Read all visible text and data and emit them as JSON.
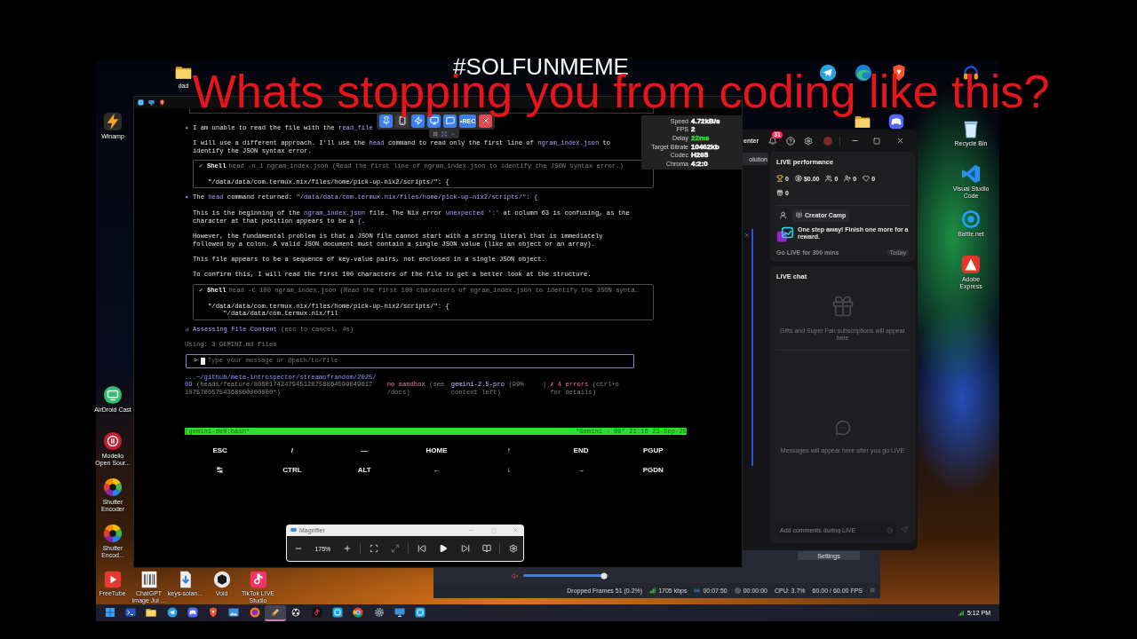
{
  "overlay": {
    "hashtag": "#SOLFUNMEME",
    "caption": "Whats stopping you from coding like this?"
  },
  "desktop": {
    "top_icons": [
      {
        "kind": "folder",
        "label": "dad"
      }
    ],
    "left_icons": [
      {
        "kind": "bolt",
        "label": "Winamp"
      },
      {
        "kind": "cast",
        "label": "AirDroid Cast"
      },
      {
        "kind": "pause",
        "label": "Modelio Open Sour..."
      },
      {
        "kind": "aperture",
        "label": "Shutter Encoder"
      },
      {
        "kind": "aperture",
        "label": "Shutter Encod..."
      }
    ],
    "right_icons": [
      {
        "kind": "bin",
        "label": "Recycle Bin"
      },
      {
        "kind": "code",
        "label": "Visual Studio Code"
      },
      {
        "kind": "swirl",
        "label": "Battle.net"
      },
      {
        "kind": "triangle",
        "label": "Adobe Express"
      }
    ],
    "bottom_icons": [
      {
        "kind": "film",
        "label": "FreeTube"
      },
      {
        "kind": "image",
        "label": "ChatGPT Image Jul ..."
      },
      {
        "kind": "file",
        "label": "keys-solan..."
      },
      {
        "kind": "cube",
        "label": "Void"
      },
      {
        "kind": "note",
        "label": "TikTok LIVE Studio"
      }
    ]
  },
  "terminal": {
    "blocks": [
      {
        "kind": "message",
        "bullet": "✦",
        "parts": [
          {
            "kind": "plain",
            "text": "I am unable to read the file with the "
          },
          {
            "kind": "code",
            "text": "read_file"
          }
        ]
      },
      {
        "kind": "text",
        "parts": [
          {
            "kind": "plain",
            "text": "I will use a different approach. I'll use the "
          },
          {
            "kind": "code",
            "text": "head"
          },
          {
            "kind": "plain",
            "text": " command to read only the first line of "
          },
          {
            "kind": "code",
            "text": "ngram_index.json"
          },
          {
            "kind": "plain",
            "text": " to identify the JSON syntax error."
          }
        ]
      },
      {
        "kind": "shell",
        "status": "✓",
        "tool": "Shell",
        "command": "head -n 1 ngram_index.json (Read the first line of ngram_index.json to identify the JSON syntax error.)",
        "output": [
          "\"/data/data/com.termux.nix/files/home/pick-up-nix2/scripts/\": {"
        ]
      },
      {
        "kind": "message",
        "bullet": "✦",
        "parts": [
          {
            "kind": "plain",
            "text": "The "
          },
          {
            "kind": "code",
            "text": "head"
          },
          {
            "kind": "plain",
            "text": " command returned: "
          },
          {
            "kind": "code",
            "text": "\"/data/data/com.termux.nix/files/home/pick-up-nix2/scripts/\": {"
          }
        ]
      },
      {
        "kind": "text",
        "parts": [
          {
            "kind": "plain",
            "text": "This is the beginning of the "
          },
          {
            "kind": "code",
            "text": "ngram_index.json"
          },
          {
            "kind": "plain",
            "text": " file. The Nix error "
          },
          {
            "kind": "code",
            "text": "unexpected ':'"
          },
          {
            "kind": "plain",
            "text": " at column 63 is confusing, as the character at that position appears to be a "
          },
          {
            "kind": "code",
            "text": "{"
          },
          {
            "kind": "plain",
            "text": "."
          }
        ]
      },
      {
        "kind": "text",
        "parts": [
          {
            "kind": "plain",
            "text": "However, the fundamental problem is that a JSON file cannot start with a string literal that is immediately followed by a colon. A valid JSON document must contain a single JSON value (like an object or an array)."
          }
        ]
      },
      {
        "kind": "text",
        "parts": [
          {
            "kind": "plain",
            "text": "This file appears to be a sequence of key-value pairs, not enclosed in a single JSON object."
          }
        ]
      },
      {
        "kind": "text",
        "parts": [
          {
            "kind": "plain",
            "text": "To confirm this, I will read the first 100 characters of the file to get a better look at the structure."
          }
        ]
      },
      {
        "kind": "shell",
        "status": "✓",
        "tool": "Shell",
        "command": "head -c 100 ngram_index.json (Read the first 100 characters of ngram_index.json to identify the JSON synta…",
        "output": [
          "\"/data/data/com.termux.nix/files/home/pick-up-nix2/scripts/\": {",
          "    \"/data/data/com.termux.nix/fil"
        ]
      }
    ],
    "spinner": {
      "icon": "⠴",
      "label": "Assessing File Content",
      "hint": "(esc to cancel, 4s)"
    },
    "context": "Using: 3 GEMINI.md files",
    "prompt": {
      "symbol": ">",
      "placeholder": "Type your message or @path/to/file"
    },
    "footer": {
      "path": "...~/github/meta-introspector/streamofrandom/2025/09",
      "branch": "(heads/feature/808017424794512875886459904961710757005754368000000000*)",
      "sandbox": "no sandbox",
      "sandbox_hint": "(see /docs)",
      "model": "gemini-2.5-pro",
      "model_hint": "(99% context left)",
      "separator": "|",
      "errors": "✗ 4 errors",
      "errors_hint": "(ctrl+o for details)"
    },
    "tmux": {
      "left": "[gemini-de0:bash*",
      "right": "\"Gemini - 09\" 21:16 23-Sep-25"
    },
    "extra_keys": [
      [
        "ESC",
        "/",
        "—",
        "HOME",
        "↑",
        "END",
        "PGUP"
      ],
      [
        "↹",
        "CTRL",
        "ALT",
        "←",
        "↓",
        "→",
        "PGDN"
      ]
    ]
  },
  "stream_stats": [
    {
      "label": "Speed",
      "value": "4.72kB/s",
      "color": "#ffffff"
    },
    {
      "label": "FPS",
      "value": "2",
      "color": "#ffffff"
    },
    {
      "label": "Delay",
      "value": "22ms",
      "color": "#33dd33"
    },
    {
      "label": "Target Bitrate",
      "value": "10462kb",
      "color": "#ffffff"
    },
    {
      "label": "Codec",
      "value": "H265",
      "color": "#ffffff"
    },
    {
      "label": "Chroma",
      "value": "4:2:0",
      "color": "#ffffff"
    }
  ],
  "mirror_toolbar": {
    "buttons": [
      {
        "kind": "pin"
      },
      {
        "kind": "phone"
      },
      {
        "kind": "bolt"
      },
      {
        "kind": "screen"
      },
      {
        "kind": "chat"
      },
      {
        "kind": "record",
        "label": "•REC"
      },
      {
        "kind": "close"
      }
    ]
  },
  "live_studio": {
    "tab_fragment": "enter",
    "notifications": "31",
    "side_button": "olution",
    "performance": {
      "title": "LIVE performance",
      "stats": [
        {
          "kind": "trophy",
          "value": "0"
        },
        {
          "kind": "coin",
          "value": "$0.00"
        },
        {
          "kind": "viewers",
          "value": "0"
        },
        {
          "kind": "follow",
          "value": "0"
        },
        {
          "kind": "like",
          "value": "0"
        },
        {
          "kind": "gift",
          "value": "0"
        }
      ],
      "program": "Creator Camp",
      "task": "One step away! Finish one more for a reward.",
      "goal": "Go LIVE for 300 mins",
      "due": "Today"
    },
    "chat": {
      "title": "LIVE chat",
      "gifts_hint": "Gifts and Super Fan subscriptions will appear here",
      "messages_hint": "Messages will appear here after you go LIVE",
      "input_placeholder": "Add comments during LIVE"
    }
  },
  "obs": {
    "settings": "Settings",
    "volume": {
      "level": 0.94
    },
    "status": [
      {
        "kind": "dropped",
        "text": "Dropped Frames 51 (0.2%)"
      },
      {
        "kind": "bitrate",
        "text": "1705 kbps"
      },
      {
        "kind": "stream_time",
        "text": "00:07:50"
      },
      {
        "kind": "rec_time",
        "text": "00:00:00"
      },
      {
        "kind": "cpu",
        "text": "CPU: 3.7%"
      },
      {
        "kind": "fps",
        "text": "60.00 / 60.00 FPS"
      }
    ]
  },
  "magnifier": {
    "title": "Magnifier",
    "zoom": "175%"
  },
  "taskbar": {
    "apps": [
      {
        "kind": "start",
        "selected": false
      },
      {
        "kind": "terminal",
        "selected": false
      },
      {
        "kind": "folder",
        "selected": false
      },
      {
        "kind": "plane",
        "selected": false
      },
      {
        "kind": "controller",
        "selected": false
      },
      {
        "kind": "shield",
        "selected": false
      },
      {
        "kind": "photo",
        "selected": false
      },
      {
        "kind": "globe",
        "selected": false
      },
      {
        "kind": "pen",
        "selected": true
      },
      {
        "kind": "ring",
        "selected": false
      },
      {
        "kind": "tiknote",
        "selected": false
      },
      {
        "kind": "tile",
        "selected": false
      },
      {
        "kind": "segring",
        "selected": false
      },
      {
        "kind": "gear",
        "selected": false
      },
      {
        "kind": "monitor",
        "selected": false
      },
      {
        "kind": "tile",
        "selected": false
      }
    ],
    "time": "5:12 PM"
  }
}
